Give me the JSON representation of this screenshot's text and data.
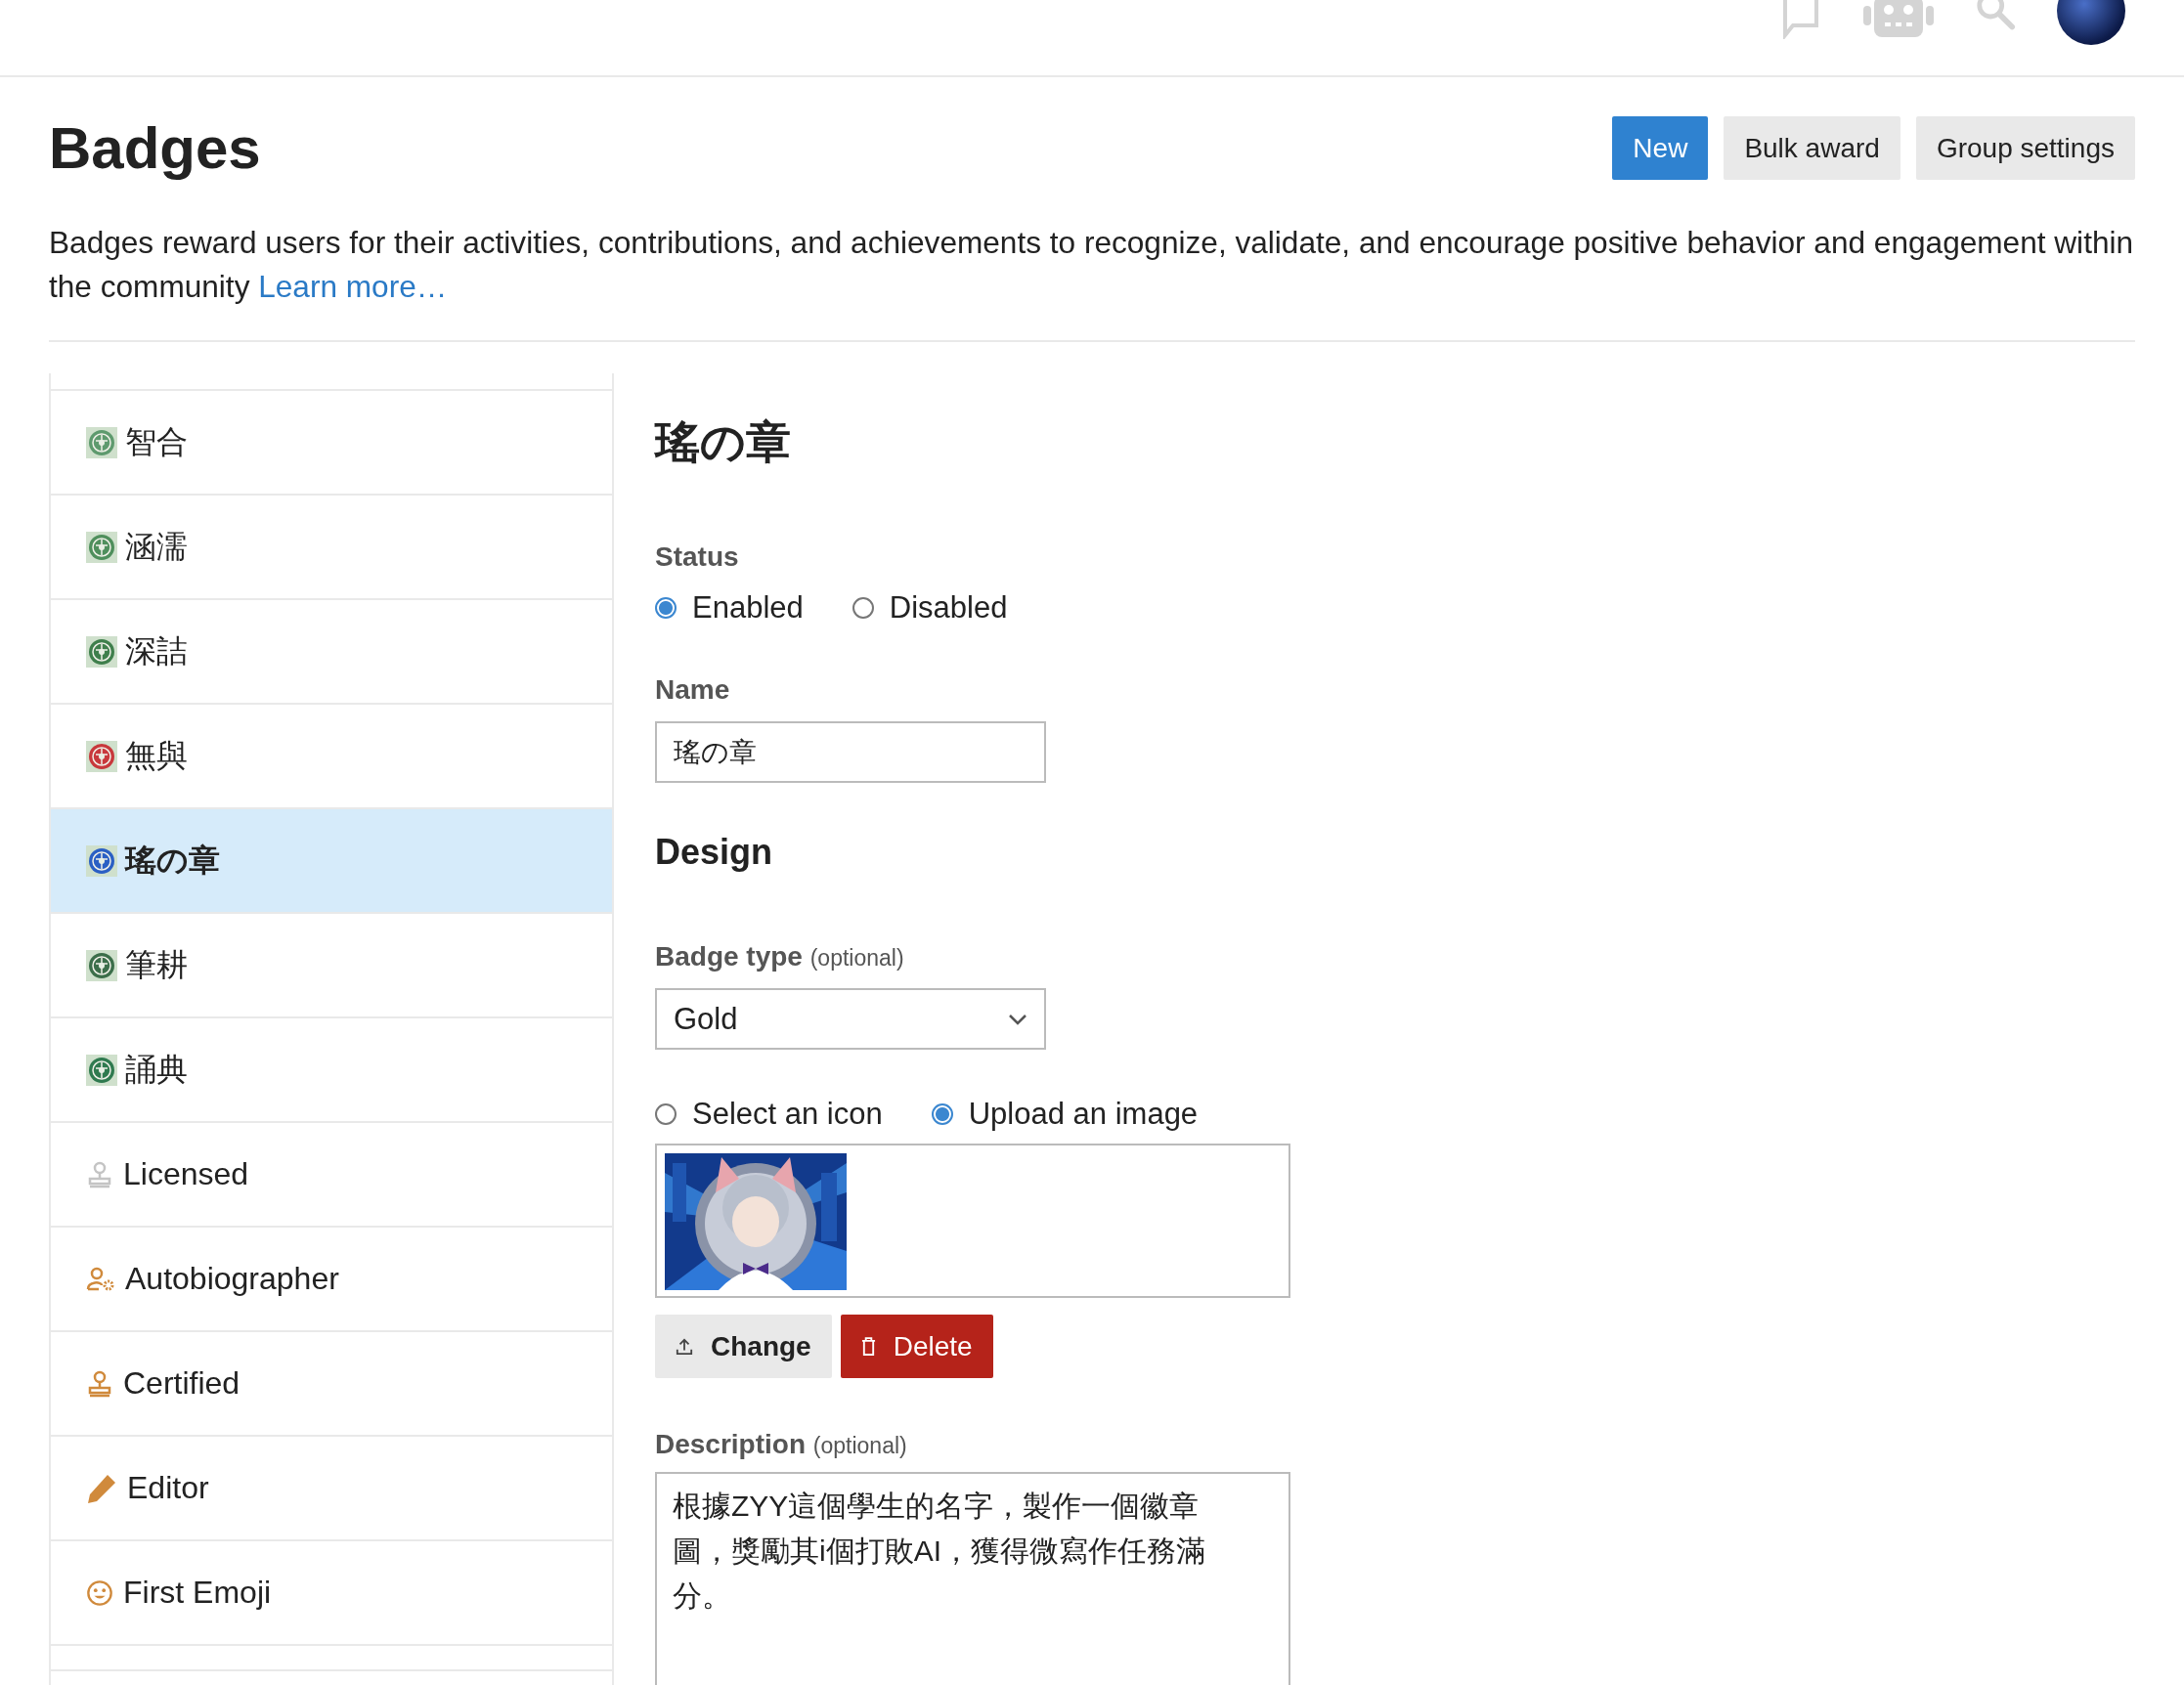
{
  "header": {
    "icons": [
      {
        "kind": "chat"
      },
      {
        "kind": "robot"
      },
      {
        "kind": "search"
      },
      {
        "kind": "avatar"
      }
    ]
  },
  "page": {
    "title": "Badges",
    "buttons": [
      {
        "label": "New",
        "kind": "primary"
      },
      {
        "label": "Bulk award",
        "kind": "secondary"
      },
      {
        "label": "Group settings",
        "kind": "secondary"
      }
    ],
    "description": "Badges reward users for their activities, contributions, and achievements to recognize, validate, and encourage positive behavior and engagement within the community",
    "learn_more": "Learn more…"
  },
  "sidebar": {
    "items": [
      {
        "label": "智合",
        "kind": "picture",
        "color": "#5e9a6e",
        "selected": false
      },
      {
        "label": "涵濡",
        "kind": "picture",
        "color": "#4f8f5c",
        "selected": false
      },
      {
        "label": "深詰",
        "kind": "picture",
        "color": "#3f7f4c",
        "selected": false
      },
      {
        "label": "無與",
        "kind": "picture",
        "color": "#c8383c",
        "selected": false
      },
      {
        "label": "瑤の章",
        "kind": "picture",
        "color": "#2a5fc4",
        "selected": true
      },
      {
        "label": "筆耕",
        "kind": "picture",
        "color": "#3c6e4a",
        "selected": false
      },
      {
        "label": "誦典",
        "kind": "picture",
        "color": "#2f7a4f",
        "selected": false
      },
      {
        "label": "Licensed",
        "kind": "stamp",
        "color": "#c4c4c4",
        "selected": false
      },
      {
        "label": "Autobiographer",
        "kind": "user-gear",
        "color": "#d08a3c",
        "selected": false
      },
      {
        "label": "Certified",
        "kind": "stamp",
        "color": "#d08a3c",
        "selected": false
      },
      {
        "label": "Editor",
        "kind": "pencil",
        "color": "#d08a3c",
        "selected": false
      },
      {
        "label": "First Emoji",
        "kind": "smile",
        "color": "#d08a3c",
        "selected": false
      }
    ]
  },
  "form": {
    "title": "瑤の章",
    "status": {
      "label": "Status",
      "options": [
        {
          "label": "Enabled",
          "selected": true
        },
        {
          "label": "Disabled",
          "selected": false
        }
      ]
    },
    "name": {
      "label": "Name",
      "value": "瑤の章"
    },
    "design_heading": "Design",
    "badge_type": {
      "label": "Badge type",
      "hint": "(optional)",
      "value": "Gold"
    },
    "image_source": {
      "options": [
        {
          "label": "Select an icon",
          "selected": false
        },
        {
          "label": "Upload an image",
          "selected": true
        }
      ]
    },
    "image_buttons": [
      {
        "label": "Change",
        "kind": "upload"
      },
      {
        "label": "Delete",
        "kind": "delete"
      }
    ],
    "description": {
      "label": "Description",
      "hint": "(optional)",
      "value": "根據ZYY這個學生的名字，製作一個徽章圖，獎勵其i個打敗AI，獲得微寫作任務滿分。"
    }
  }
}
